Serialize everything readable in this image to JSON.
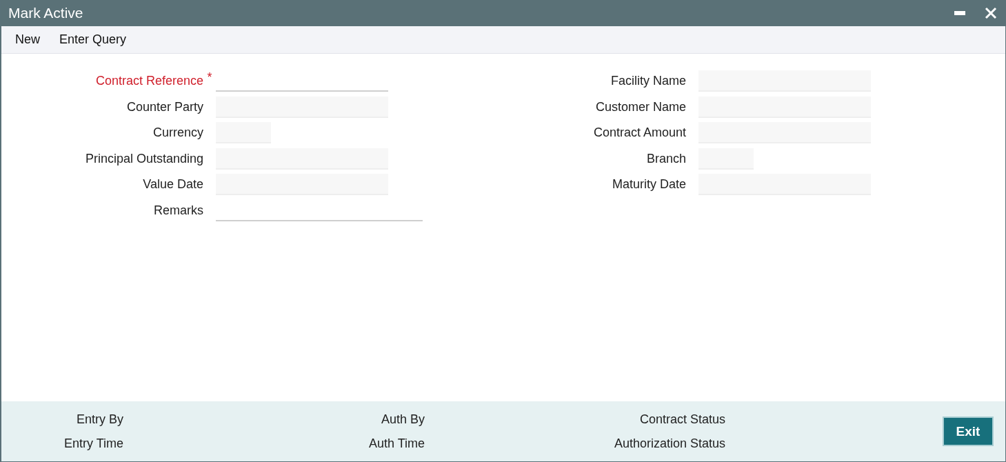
{
  "window": {
    "title": "Mark Active"
  },
  "toolbar": [
    {
      "label": "New"
    },
    {
      "label": "Enter Query"
    }
  ],
  "required_marker": "*",
  "left_fields": [
    {
      "label": "Contract Reference",
      "kind": "line",
      "required": true
    },
    {
      "label": "Counter Party",
      "kind": "text",
      "required": false
    },
    {
      "label": "Currency",
      "kind": "code",
      "required": false
    },
    {
      "label": "Principal Outstanding",
      "kind": "text",
      "required": false
    },
    {
      "label": "Value Date",
      "kind": "text",
      "required": false
    },
    {
      "label": "Remarks",
      "kind": "memo",
      "required": false
    }
  ],
  "right_fields": [
    {
      "label": "Facility Name",
      "kind": "text",
      "required": false
    },
    {
      "label": "Customer Name",
      "kind": "text",
      "required": false
    },
    {
      "label": "Contract Amount",
      "kind": "text",
      "required": false
    },
    {
      "label": "Branch",
      "kind": "code",
      "required": false
    },
    {
      "label": "Maturity Date",
      "kind": "text",
      "required": false
    }
  ],
  "footer": {
    "columns": [
      [
        "Entry By",
        "Entry Time"
      ],
      [
        "Auth By",
        "Auth Time"
      ],
      [
        "Contract Status",
        "Authorization Status"
      ]
    ],
    "exit_button": "Exit"
  }
}
